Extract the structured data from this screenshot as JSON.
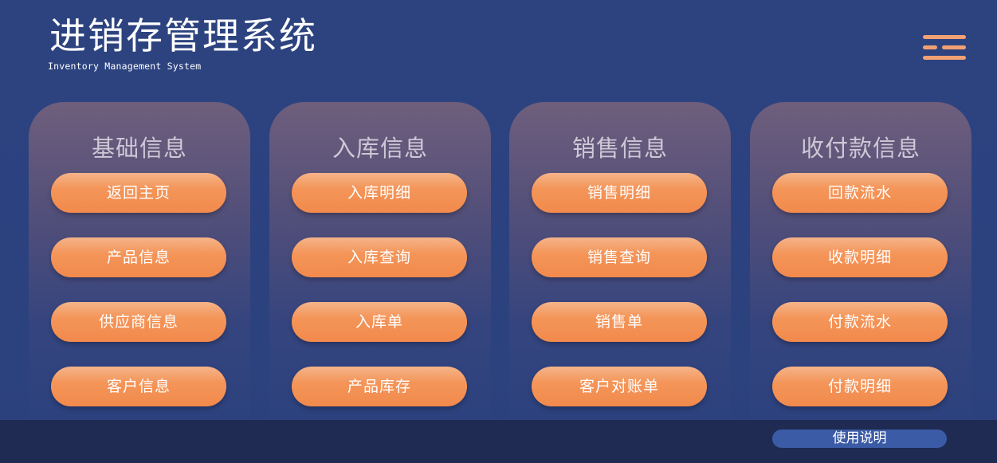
{
  "header": {
    "title": "进销存管理系统",
    "subtitle": "Inventory Management System",
    "menu_icon": "hamburger-menu-icon"
  },
  "panels": [
    {
      "title": "基础信息",
      "buttons": [
        "返回主页",
        "产品信息",
        "供应商信息",
        "客户信息"
      ]
    },
    {
      "title": "入库信息",
      "buttons": [
        "入库明细",
        "入库查询",
        "入库单",
        "产品库存"
      ]
    },
    {
      "title": "销售信息",
      "buttons": [
        "销售明细",
        "销售查询",
        "销售单",
        "客户对账单"
      ]
    },
    {
      "title": "收付款信息",
      "buttons": [
        "回款流水",
        "收款明细",
        "付款流水",
        "付款明细"
      ]
    }
  ],
  "footer": {
    "help_label": "使用说明"
  },
  "colors": {
    "background": "#2d4380",
    "button_orange": "#f49559",
    "menu_icon": "#f3a073",
    "footer": "#1f2b52",
    "help_button": "#3b5ba6"
  }
}
